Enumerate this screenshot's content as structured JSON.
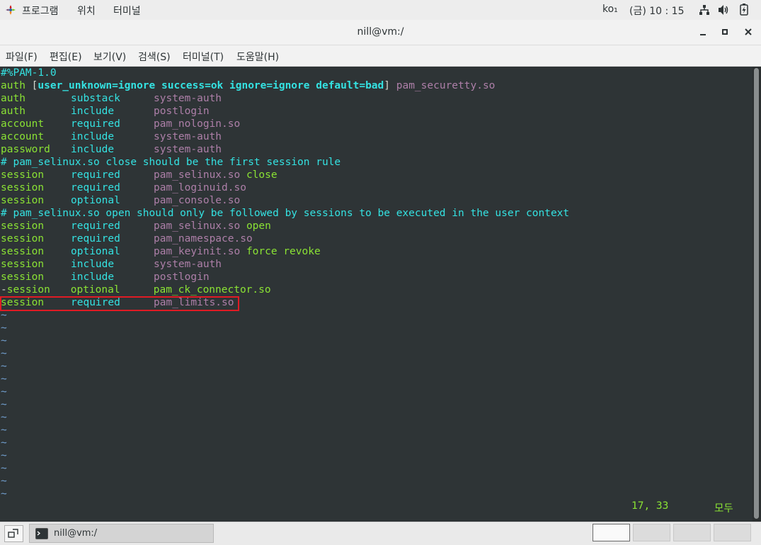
{
  "topbar": {
    "applications": "프로그램",
    "places": "위치",
    "terminal": "터미널",
    "input_method": "ko₁",
    "clock": "(금) 10 : 15"
  },
  "window": {
    "title": "nill@vm:/"
  },
  "menu": {
    "file": "파일(F)",
    "edit": "편집(E)",
    "view": "보기(V)",
    "search": "검색(S)",
    "terminal": "터미널(T)",
    "help": "도움말(H)"
  },
  "editor": {
    "header": "#%PAM-1.0",
    "auth_bracket_line": {
      "type": "auth",
      "open": "[",
      "control": "user_unknown=ignore success=ok ignore=ignore default=bad",
      "close": "]",
      "module": "pam_securetty.so"
    },
    "lines": [
      {
        "type": "auth",
        "control": "substack",
        "module": "system-auth",
        "args": ""
      },
      {
        "type": "auth",
        "control": "include",
        "module": "postlogin",
        "args": ""
      },
      {
        "type": "account",
        "control": "required",
        "module": "pam_nologin.so",
        "args": ""
      },
      {
        "type": "account",
        "control": "include",
        "module": "system-auth",
        "args": ""
      },
      {
        "type": "password",
        "control": "include",
        "module": "system-auth",
        "args": ""
      }
    ],
    "comment1": "# pam_selinux.so close should be the first session rule",
    "lines2": [
      {
        "type": "session",
        "control": "required",
        "module": "pam_selinux.so",
        "args": "close"
      },
      {
        "type": "session",
        "control": "required",
        "module": "pam_loginuid.so",
        "args": ""
      },
      {
        "type": "session",
        "control": "optional",
        "module": "pam_console.so",
        "args": ""
      }
    ],
    "comment2": "# pam_selinux.so open should only be followed by sessions to be executed in the user context",
    "lines3": [
      {
        "type": "session",
        "control": "required",
        "module": "pam_selinux.so",
        "args": "open"
      },
      {
        "type": "session",
        "control": "required",
        "module": "pam_namespace.so",
        "args": ""
      },
      {
        "type": "session",
        "control": "optional",
        "module": "pam_keyinit.so",
        "args": "force revoke"
      },
      {
        "type": "session",
        "control": "include",
        "module": "system-auth",
        "args": ""
      },
      {
        "type": "session",
        "control": "include",
        "module": "postlogin",
        "args": ""
      }
    ],
    "dash_line": {
      "prefix": "-",
      "type": "session",
      "control": "optional",
      "module": "pam_ck_connector.so"
    },
    "highlighted_line": {
      "type": "session",
      "control": "required",
      "module": "pam_limits.so"
    },
    "tilde": "~",
    "cursor_position": "17, 33",
    "scroll_position": "모두"
  },
  "taskbar": {
    "window_button": "nill@vm:/"
  }
}
